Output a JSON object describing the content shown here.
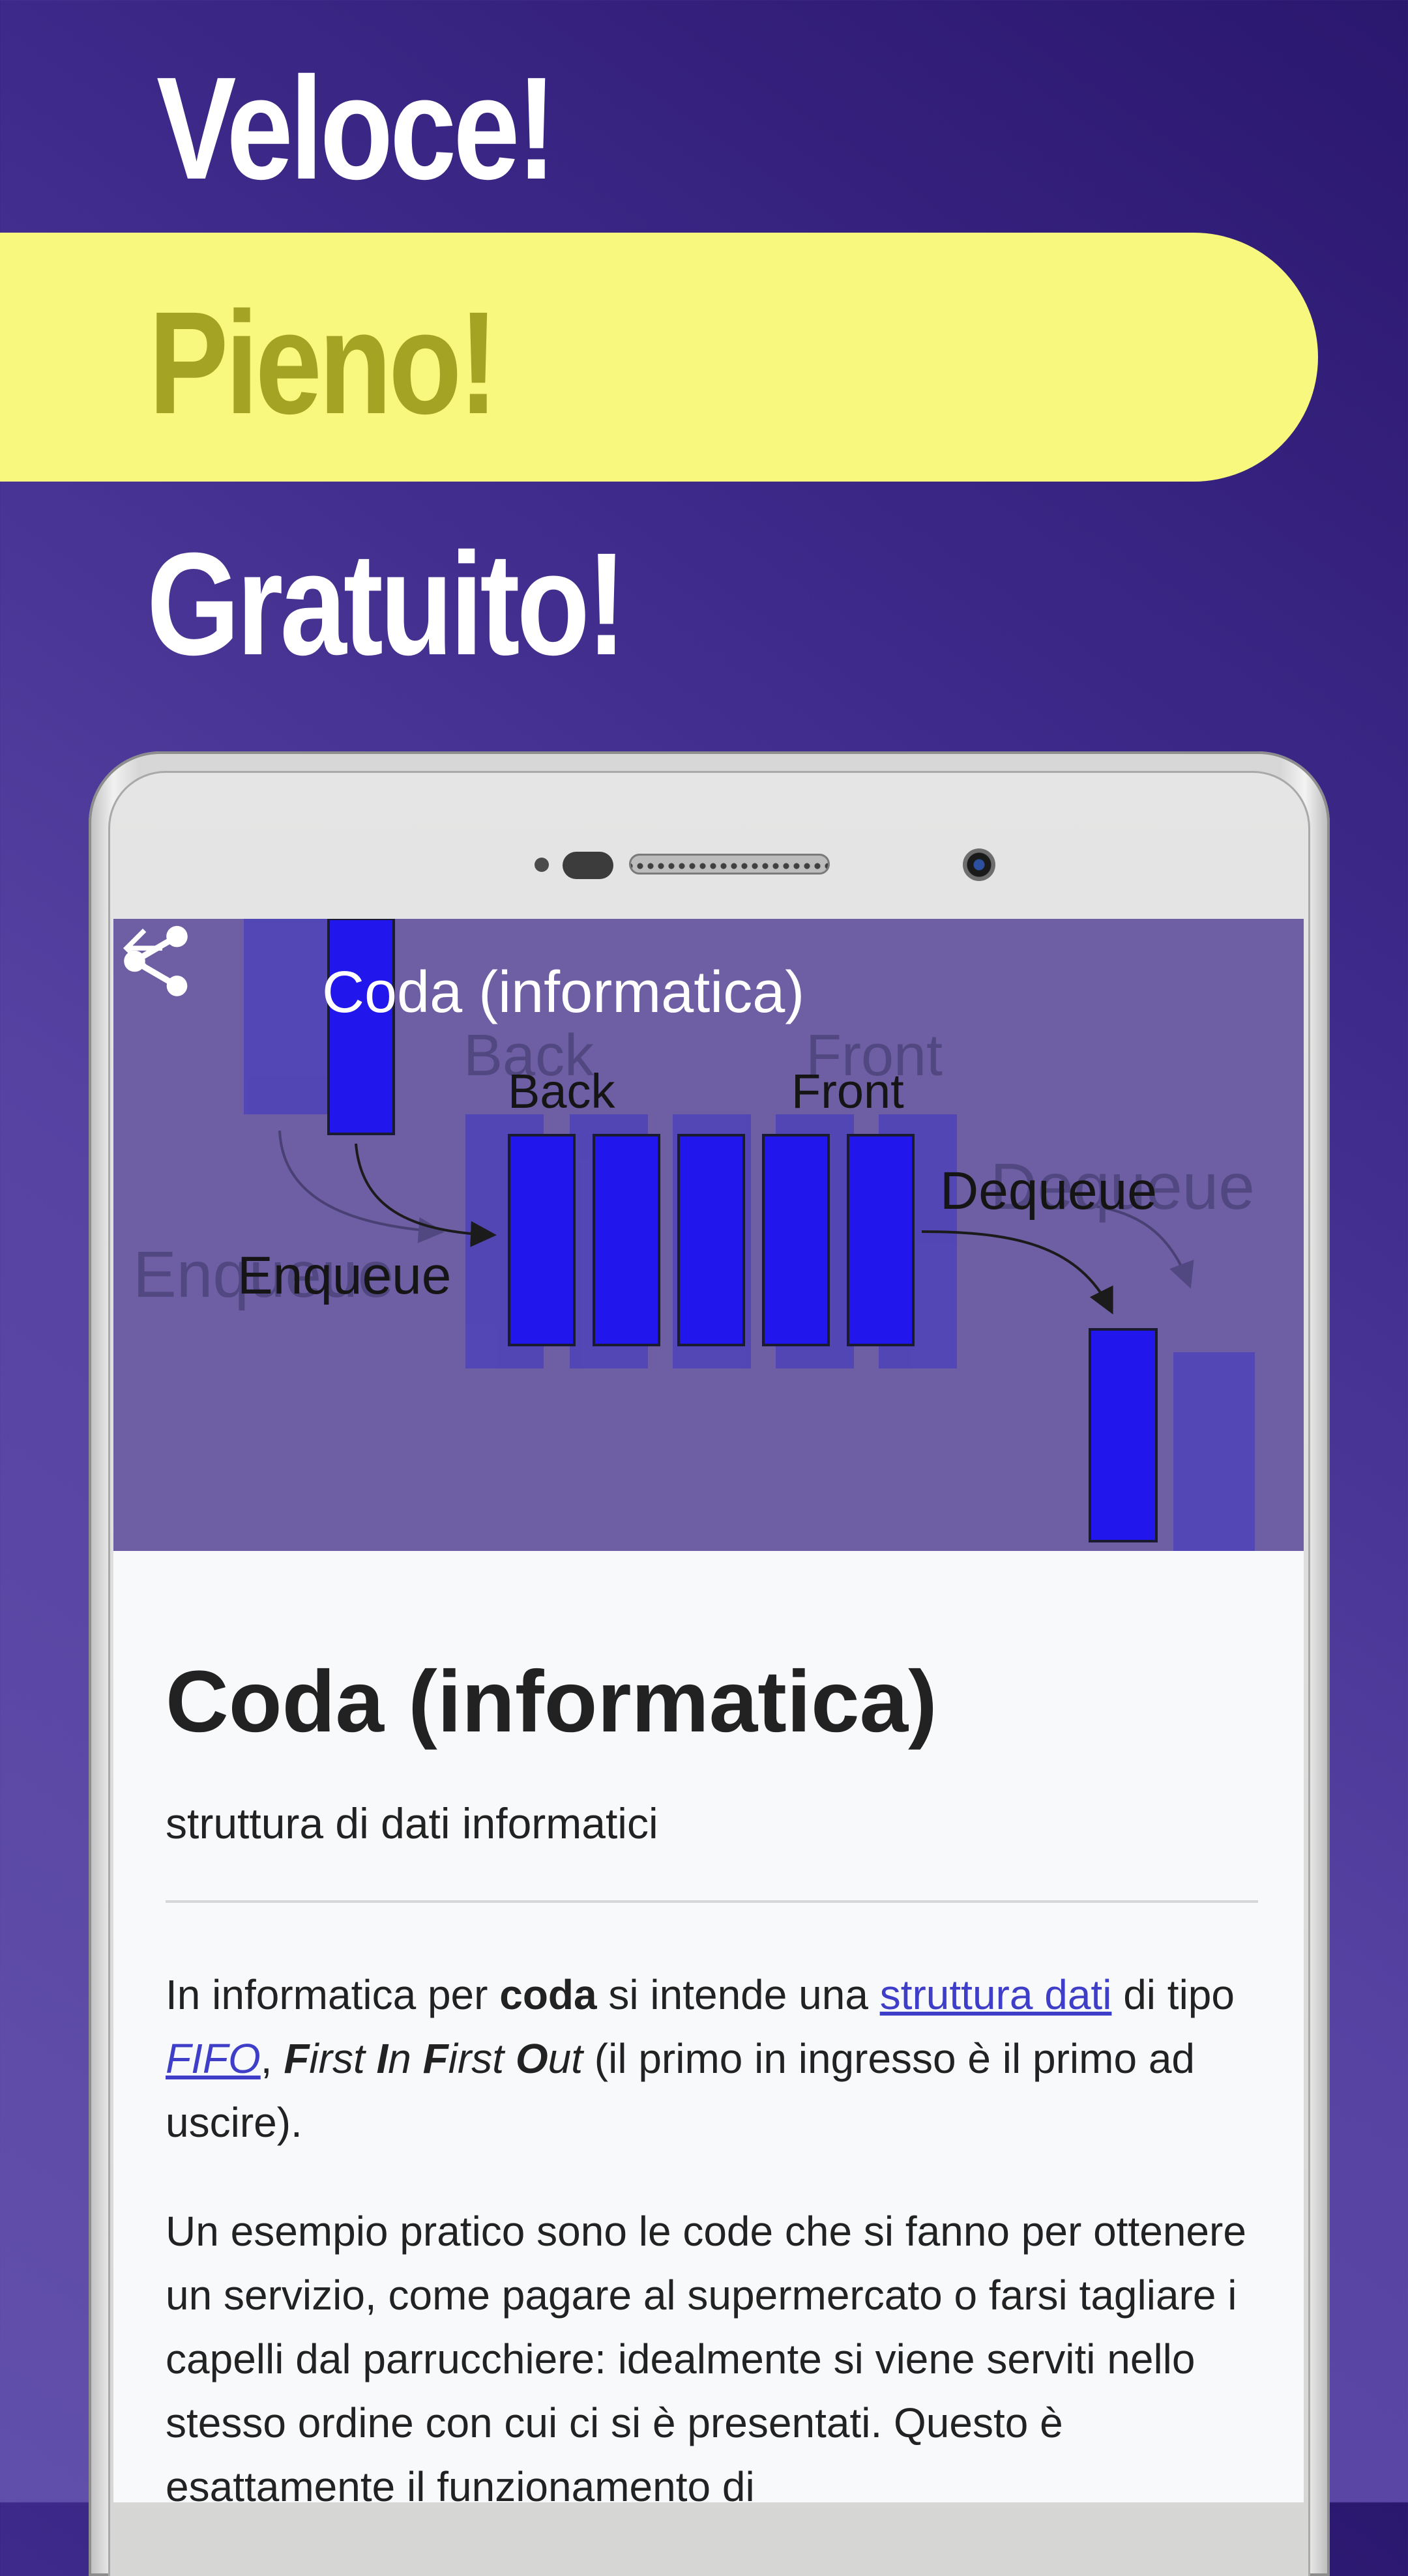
{
  "headlines": {
    "line1": "Veloce!",
    "line2": "Pieno!",
    "line3": "Gratuito!"
  },
  "colors": {
    "background_top": "#2a176e",
    "background_bottom": "#6150ab",
    "pill": "#f8f87e",
    "pill_text": "#a4a323",
    "hero_overlay": "#6e5ea3",
    "link": "#3f3ec8"
  },
  "toolbar": {
    "back_icon": "arrow-left-icon",
    "title": "Coda (informatica)",
    "share_icon": "share-icon"
  },
  "diagram": {
    "label_back": "Back",
    "label_front": "Front",
    "label_enqueue": "Enqueue",
    "label_dequeue": "Dequeue"
  },
  "article": {
    "title": "Coda (informatica)",
    "subtitle": "struttura di dati informatici",
    "p1": {
      "t1": "In informatica per ",
      "bold_coda": "coda",
      "t2": " si intende una ",
      "link_struttura": "struttura dati",
      "t3": " di tipo ",
      "link_fifo": "FIFO",
      "t4": ", ",
      "f1": "F",
      "irst1": "irst ",
      "i": "I",
      "n": "n ",
      "f2": "F",
      "irst2": "irst ",
      "o": "O",
      "ut": "ut",
      "t5": " (il primo in ingresso è il primo ad uscire)."
    },
    "p2": "Un esempio pratico sono le code che si fanno per ottenere un servizio, come pagare al supermercato o farsi tagliare i capelli dal parrucchiere: idealmente si viene serviti nello stesso ordine con cui ci si è presentati. Questo è esattamente il funzionamento di"
  }
}
